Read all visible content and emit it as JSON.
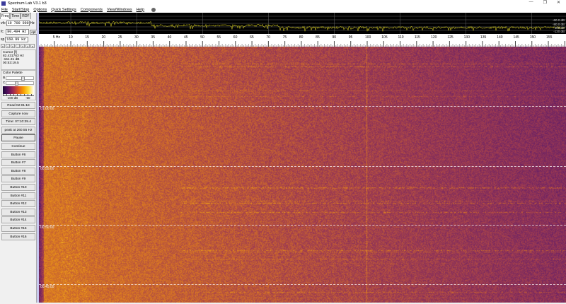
{
  "window": {
    "title": "Spectrum Lab V3.1 b3",
    "minimize": "—",
    "maximize": "❐",
    "close": "✕"
  },
  "menu": [
    "File",
    "Start/Stop",
    "Options",
    "Quick Settings",
    "Components",
    "View/Windows",
    "Help"
  ],
  "tabs": [
    "Freq",
    "Time",
    "RDF"
  ],
  "freq": {
    "vfo_label": "vfo",
    "vfo": "10 700 000",
    "vfo_unit": "Hz",
    "fc_label": "fc",
    "fc": "80.494 Hz",
    "opt": "opt",
    "sp_label": "sp",
    "sp": "160.99 Hz"
  },
  "arrows": [
    "«",
    "‹",
    "<",
    "-",
    "+",
    ">",
    "»"
  ],
  "cursor": {
    "title": "Cursor [f]",
    "freq": "82.431763 Hz",
    "level": "-151.31 dB",
    "time": "00:53:19.5"
  },
  "palette": {
    "title": "Color Palette",
    "b": "B",
    "c": "C",
    "min": "-100 dB",
    "max": "-50"
  },
  "buttons": [
    "Read 02:01:18",
    "Capture now",
    "Time: 07:10:39.4",
    "peak at 260.55 Hz",
    "Pause",
    "Continue",
    "Button #6",
    "Button #7",
    "Button #8",
    "Button #9",
    "Button #10",
    "Button #11",
    "Button #12",
    "Button #13",
    "Button #14",
    "Button #15",
    "Button #16"
  ],
  "spectrum": {
    "db_labels": [
      "-60.0 dB",
      "-80.0 dB",
      "-100 dB",
      "-120 dB"
    ]
  },
  "freq_labels": [
    "5 Hz",
    "10",
    "15",
    "20",
    "25",
    "30",
    "35",
    "40",
    "45",
    "50",
    "55",
    "60",
    "65",
    "70",
    "75",
    "80",
    "85",
    "90",
    "95",
    "100",
    "105",
    "110",
    "115",
    "120",
    "125",
    "130",
    "135",
    "140",
    "145",
    "150",
    "155"
  ],
  "timestamps": [
    "01:00:00",
    "00:55:00",
    "00:50:00",
    "00:45:00"
  ]
}
